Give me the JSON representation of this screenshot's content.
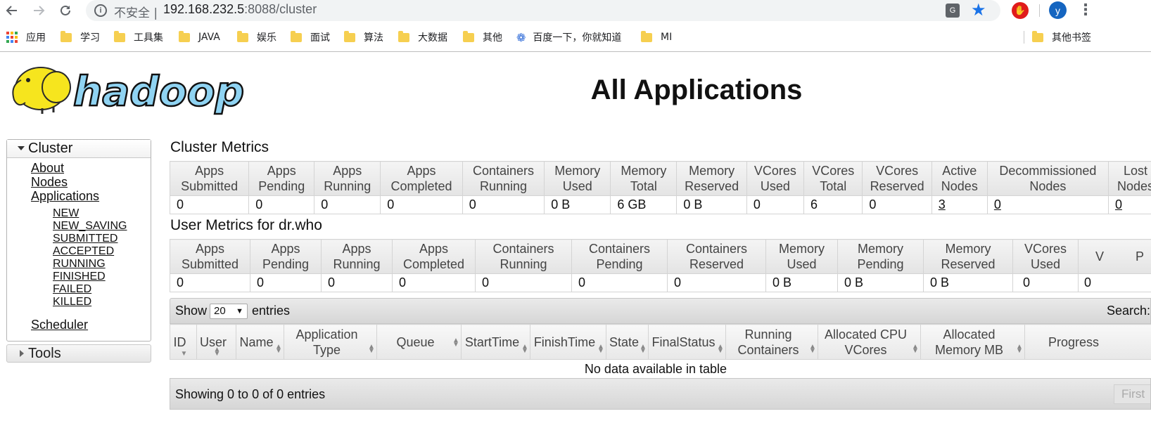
{
  "browser": {
    "insecure_label": "不安全 |",
    "url_host": "192.168.232.5",
    "url_rest": ":8088/cluster",
    "avatar_letter": "y",
    "bookmarks": [
      {
        "label": "应用",
        "icon": "apps-grid-icon"
      },
      {
        "label": "学习",
        "icon": "folder-icon"
      },
      {
        "label": "工具集",
        "icon": "folder-icon"
      },
      {
        "label": "JAVA",
        "icon": "folder-icon"
      },
      {
        "label": "娱乐",
        "icon": "folder-icon"
      },
      {
        "label": "面试",
        "icon": "folder-icon"
      },
      {
        "label": "算法",
        "icon": "folder-icon"
      },
      {
        "label": "大数据",
        "icon": "folder-icon"
      },
      {
        "label": "其他",
        "icon": "folder-icon"
      },
      {
        "label": "百度一下，你就知道",
        "icon": "baidu-paw-icon"
      },
      {
        "label": "MI",
        "icon": "folder-icon"
      }
    ],
    "other_bookmarks": "其他书签"
  },
  "page": {
    "title": "All Applications",
    "logo_text": "hadoop"
  },
  "sidebar": {
    "cluster_label": "Cluster",
    "links": [
      "About",
      "Nodes",
      "Applications"
    ],
    "app_states": [
      "NEW",
      "NEW_SAVING",
      "SUBMITTED",
      "ACCEPTED",
      "RUNNING",
      "FINISHED",
      "FAILED",
      "KILLED"
    ],
    "scheduler": "Scheduler",
    "tools_label": "Tools"
  },
  "cluster_metrics": {
    "title": "Cluster Metrics",
    "headers": [
      "Apps Submitted",
      "Apps Pending",
      "Apps Running",
      "Apps Completed",
      "Containers Running",
      "Memory Used",
      "Memory Total",
      "Memory Reserved",
      "VCores Used",
      "VCores Total",
      "VCores Reserved",
      "Active Nodes",
      "Decommissioned Nodes",
      "Lost Nodes"
    ],
    "values": [
      "0",
      "0",
      "0",
      "0",
      "0",
      "0 B",
      "6 GB",
      "0 B",
      "0",
      "6",
      "0",
      "3",
      "0",
      "0"
    ]
  },
  "user_metrics": {
    "title": "User Metrics for dr.who",
    "headers": [
      "Apps Submitted",
      "Apps Pending",
      "Apps Running",
      "Apps Completed",
      "Containers Running",
      "Containers Pending",
      "Containers Reserved",
      "Memory Used",
      "Memory Pending",
      "Memory Reserved",
      "VCores Used",
      "V P"
    ],
    "values": [
      "0",
      "0",
      "0",
      "0",
      "0",
      "0",
      "0",
      "0 B",
      "0 B",
      "0 B",
      "0",
      "0"
    ]
  },
  "apps_table": {
    "show_label": "Show",
    "page_size": "20",
    "entries_label": "entries",
    "search_label": "Search:",
    "headers": [
      "ID",
      "User",
      "Name",
      "Application Type",
      "Queue",
      "StartTime",
      "FinishTime",
      "State",
      "FinalStatus",
      "Running Containers",
      "Allocated CPU VCores",
      "Allocated Memory MB",
      "Progress"
    ],
    "empty_message": "No data available in table",
    "info": "Showing 0 to 0 of 0 entries",
    "first_label": "First"
  }
}
